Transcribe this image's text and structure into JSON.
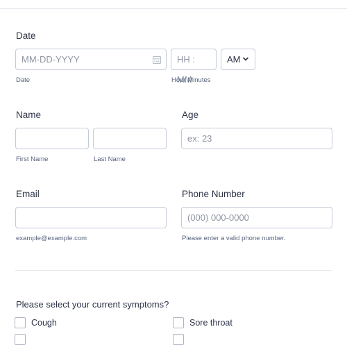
{
  "date_field": {
    "label": "Date",
    "date_placeholder": "MM-DD-YYYY",
    "date_sublabel": "Date",
    "time_placeholder": "HH : MM",
    "time_sublabel": "Hour Minutes",
    "ampm_value": "AM",
    "calendar_icon": "calendar-icon",
    "chevron_icon": "chevron-down-icon"
  },
  "name_field": {
    "label": "Name",
    "first_sublabel": "First Name",
    "last_sublabel": "Last Name",
    "first_value": "",
    "last_value": ""
  },
  "age_field": {
    "label": "Age",
    "placeholder": "ex: 23"
  },
  "email_field": {
    "label": "Email",
    "sublabel": "example@example.com",
    "value": ""
  },
  "phone_field": {
    "label": "Phone Number",
    "placeholder": "(000) 000-0000",
    "sublabel": "Please enter a valid phone number."
  },
  "symptoms": {
    "question": "Please select your current symptoms?",
    "options": [
      "Cough",
      "Sore throat"
    ]
  },
  "colors": {
    "text": "#2c3345",
    "border": "#c3cad8",
    "placeholder": "#8f96a3"
  }
}
